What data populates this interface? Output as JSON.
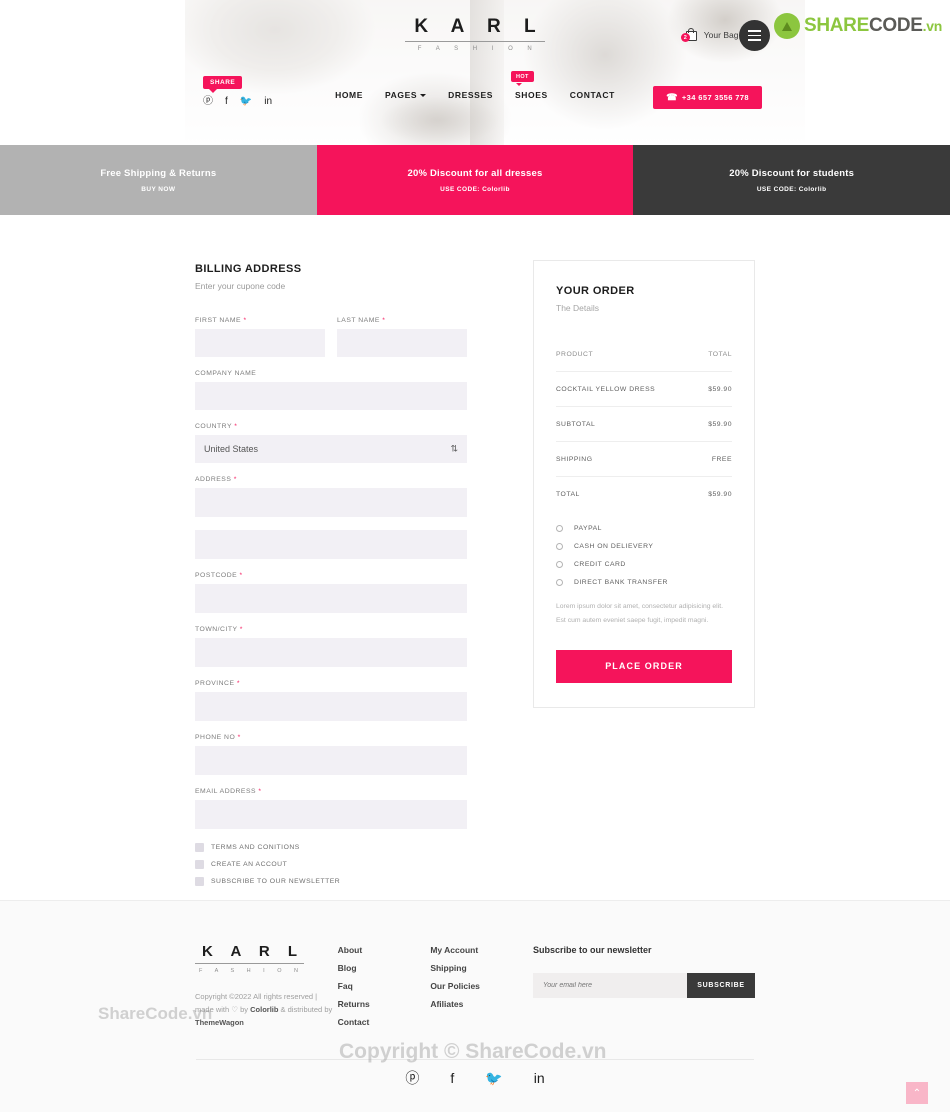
{
  "header": {
    "brand_name": "K A R L",
    "brand_sub": "F A S H I O N",
    "share_badge": "SHARE",
    "social": [
      {
        "name": "pinterest-icon",
        "glyph": "ⓟ"
      },
      {
        "name": "facebook-icon",
        "glyph": "f"
      },
      {
        "name": "twitter-icon",
        "glyph": "🐦"
      },
      {
        "name": "linkedin-icon",
        "glyph": "in"
      }
    ],
    "nav": [
      {
        "label": "HOME",
        "has_caret": false,
        "badge": null
      },
      {
        "label": "PAGES",
        "has_caret": true,
        "badge": null
      },
      {
        "label": "DRESSES",
        "has_caret": false,
        "badge": null
      },
      {
        "label": "SHOES",
        "has_caret": false,
        "badge": "HOT"
      },
      {
        "label": "CONTACT",
        "has_caret": false,
        "badge": null
      }
    ],
    "cart": {
      "count": "2",
      "label": "Your Bag $20"
    },
    "phone": "+34 657 3556 778",
    "logo": {
      "part1": "SHARE",
      "part2": "CODE",
      "part3": ".vn"
    }
  },
  "promos": [
    {
      "title": "Free Shipping & Returns",
      "sub": "BUY NOW",
      "style": "gray"
    },
    {
      "title": "20% Discount for all dresses",
      "sub": "USE CODE: Colorlib",
      "style": "pink"
    },
    {
      "title": "20% Discount for students",
      "sub": "USE CODE: Colorlib",
      "style": "dark"
    }
  ],
  "billing": {
    "title": "BILLING ADDRESS",
    "subtitle": "Enter your cupone code",
    "fields": {
      "first_name": {
        "label": "FIRST NAME",
        "required": true,
        "value": ""
      },
      "last_name": {
        "label": "LAST NAME",
        "required": true,
        "value": ""
      },
      "company_name": {
        "label": "COMPANY NAME",
        "required": false,
        "value": ""
      },
      "country": {
        "label": "COUNTRY",
        "required": true,
        "value": "United States"
      },
      "address": {
        "label": "ADDRESS",
        "required": true,
        "value": ""
      },
      "address2": {
        "label": "",
        "required": false,
        "value": ""
      },
      "postcode": {
        "label": "POSTCODE",
        "required": true,
        "value": ""
      },
      "town_city": {
        "label": "TOWN/CITY",
        "required": true,
        "value": ""
      },
      "province": {
        "label": "PROVINCE",
        "required": true,
        "value": ""
      },
      "phone_no": {
        "label": "PHONE NO",
        "required": true,
        "value": ""
      },
      "email_address": {
        "label": "EMAIL ADDRESS",
        "required": true,
        "value": ""
      }
    },
    "checkboxes": [
      {
        "label": "TERMS AND CONITIONS",
        "checked": false
      },
      {
        "label": "CREATE AN ACCOUT",
        "checked": false
      },
      {
        "label": "SUBSCRIBE TO OUR NEWSLETTER",
        "checked": false
      }
    ]
  },
  "order": {
    "title": "YOUR ORDER",
    "subtitle": "The Details",
    "head_product": "PRODUCT",
    "head_total": "TOTAL",
    "rows": [
      {
        "label": "COCKTAIL YELLOW DRESS",
        "value": "$59.90"
      },
      {
        "label": "SUBTOTAL",
        "value": "$59.90"
      },
      {
        "label": "SHIPPING",
        "value": "FREE"
      },
      {
        "label": "TOTAL",
        "value": "$59.90"
      }
    ],
    "payments": [
      {
        "label": "PAYPAL",
        "selected": false
      },
      {
        "label": "CASH ON DELIEVERY",
        "selected": false
      },
      {
        "label": "CREDIT CARD",
        "selected": false
      },
      {
        "label": "DIRECT BANK TRANSFER",
        "selected": false
      }
    ],
    "note_line1": "Lorem ipsum dolor sit amet, consectetur adipisicing elit.",
    "note_line2": "Est cum autem eveniet saepe fugit, impedit magni.",
    "place_order": "PLACE ORDER"
  },
  "footer": {
    "brand_name": "K A R L",
    "brand_sub": "F A S H I O N",
    "copyright_line1": "Copyright ©2022 All rights reserved |",
    "copyright_pre": "made with ",
    "copyright_heart": "♡",
    "copyright_mid": " by ",
    "copyright_author": "Colorlib",
    "copyright_post": " & distributed",
    "copyright_line3_pre": "by ",
    "copyright_distributor": "ThemeWagon",
    "links_col1": [
      "About",
      "Blog",
      "Faq",
      "Returns",
      "Contact"
    ],
    "links_col2": [
      "My Account",
      "Shipping",
      "Our Policies",
      "Afiliates"
    ],
    "newsletter_title": "Subscribe to our newsletter",
    "newsletter_placeholder": "Your email here",
    "newsletter_button": "SUBSCRIBE",
    "social": [
      {
        "name": "pinterest-icon",
        "glyph": "ⓟ"
      },
      {
        "name": "facebook-icon",
        "glyph": "f"
      },
      {
        "name": "twitter-icon",
        "glyph": "🐦"
      },
      {
        "name": "linkedin-icon",
        "glyph": "in"
      }
    ],
    "to_top": "⌃"
  },
  "watermarks": {
    "center": "Copyright © ShareCode.vn",
    "left": "ShareCode.vn"
  },
  "colors": {
    "accent_pink": "#f5145b",
    "dark": "#3a3a3a",
    "gray": "#b2b2b2",
    "field_bg": "#f2f0f5",
    "logo_green": "#8cc63f"
  }
}
